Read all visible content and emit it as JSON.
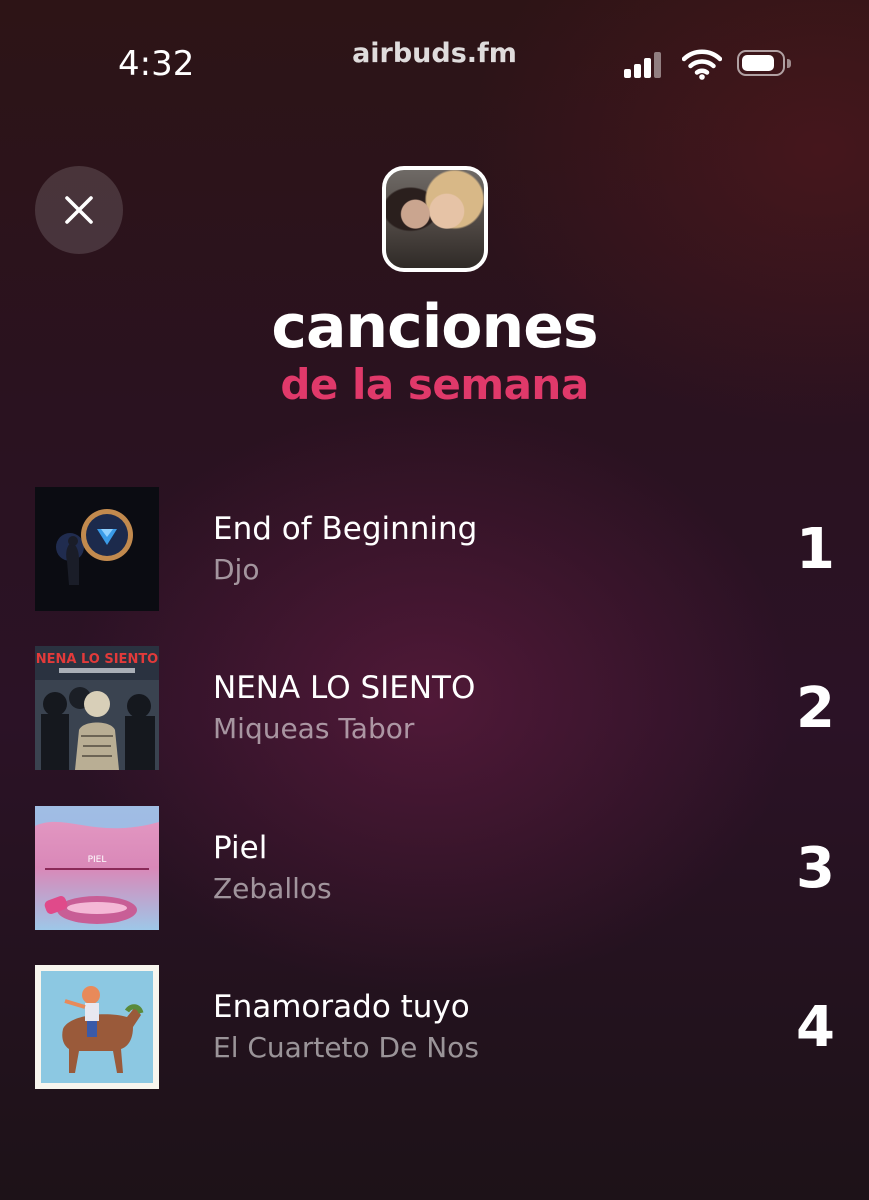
{
  "status_bar": {
    "time": "4:32",
    "url": "airbuds.fm"
  },
  "header": {
    "title": "canciones",
    "subtitle": "de la semana",
    "accent_color": "#e0396a"
  },
  "tracks": [
    {
      "title": "End of Beginning",
      "artist": "Djo",
      "rank": "1"
    },
    {
      "title": "NENA LO SIENTO",
      "artist": "Miqueas Tabor",
      "rank": "2",
      "cover_text": "NENA LO SIENTO"
    },
    {
      "title": "Piel",
      "artist": "Zeballos",
      "rank": "3",
      "cover_text": "PIEL"
    },
    {
      "title": "Enamorado tuyo",
      "artist": "El Cuarteto De Nos",
      "rank": "4"
    }
  ],
  "icons": {
    "close": "close-icon",
    "signal": "cellular-signal-icon",
    "wifi": "wifi-icon",
    "battery": "battery-icon"
  }
}
